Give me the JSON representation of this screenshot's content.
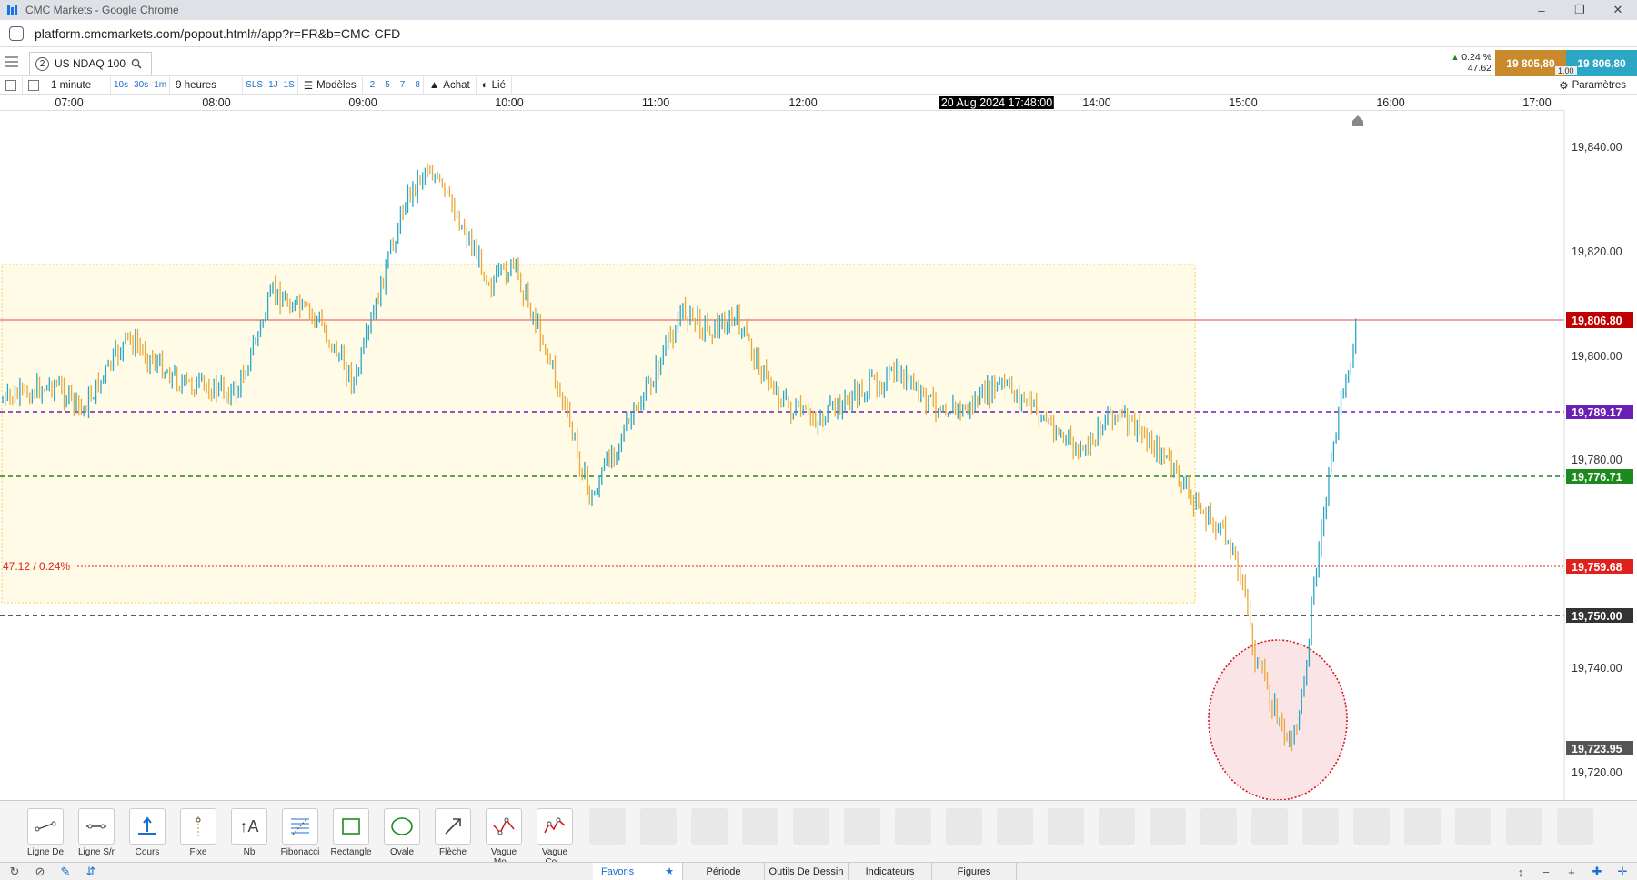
{
  "browser": {
    "title": "CMC Markets - Google Chrome",
    "url": "platform.cmcmarkets.com/popout.html#/app?r=FR&b=CMC-CFD"
  },
  "instrument": {
    "badge": "2",
    "name": "US NDAQ 100"
  },
  "quote": {
    "change_pct": "0.24 %",
    "change_pts": "47.62",
    "sell": "19 805,80",
    "buy": "19 806,80",
    "spread": "1.00"
  },
  "toolbar": {
    "interval": "1 minute",
    "quick_intervals": [
      "10s",
      "30s",
      "1m"
    ],
    "range": "9 heures",
    "sls": "SLS",
    "quick_ranges": [
      "1J",
      "1S"
    ],
    "templates": "Modèles",
    "numbers": [
      "2",
      "5",
      "7",
      "8"
    ],
    "side": "Achat",
    "linked": "Lié",
    "settings": "Paramètres"
  },
  "time_axis": {
    "labels": [
      "07:00",
      "08:00",
      "09:00",
      "10:00",
      "11:00",
      "12:00",
      "14:00",
      "15:00",
      "16:00",
      "17:00"
    ],
    "cursor": "20 Aug 2024 17:48:00"
  },
  "price_axis": {
    "labels": [
      "19,840.00",
      "19,820.00",
      "19,800.00",
      "19,780.00",
      "19,740.00",
      "19,720.00"
    ],
    "tags": [
      {
        "value": "19,806.80",
        "color": "#c00000"
      },
      {
        "value": "19,789.17",
        "color": "#6a1fb5"
      },
      {
        "value": "19,776.71",
        "color": "#1d8a1d"
      },
      {
        "value": "19,759.68",
        "color": "#e0201a"
      },
      {
        "value": "19,750.00",
        "color": "#333333"
      },
      {
        "value": "19,723.95",
        "color": "#555555"
      }
    ]
  },
  "chart_annotation": "47.12 / 0.24%",
  "colors": {
    "candle_up": "#2ba6c4",
    "candle_down": "#e8a93a",
    "zone": "#fffbe6",
    "circle": "#fbe4e6"
  },
  "tools": [
    {
      "label": "Ligne De ...",
      "icon": "line-icon"
    },
    {
      "label": "Ligne S/r",
      "icon": "sr-line-icon"
    },
    {
      "label": "Cours",
      "icon": "price-icon"
    },
    {
      "label": "Fixe",
      "icon": "fixed-icon"
    },
    {
      "label": "Nb",
      "icon": "text-icon"
    },
    {
      "label": "Fibonacci",
      "icon": "fibonacci-icon"
    },
    {
      "label": "Rectangle",
      "icon": "rectangle-icon"
    },
    {
      "label": "Ovale",
      "icon": "oval-icon"
    },
    {
      "label": "Flèche",
      "icon": "arrow-icon"
    },
    {
      "label": "Vague Mo...",
      "icon": "wave-icon"
    },
    {
      "label": "Vague Co...",
      "icon": "wave2-icon"
    }
  ],
  "bottom_tabs": [
    "Favoris",
    "Période",
    "Outils De Dessin",
    "Indicateurs",
    "Figures"
  ]
}
